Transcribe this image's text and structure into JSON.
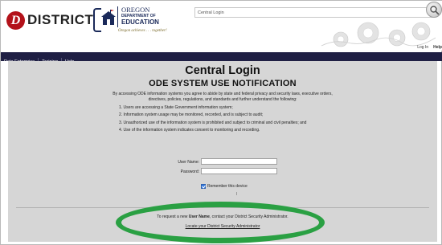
{
  "header": {
    "logo_letter": "D",
    "logo_brand": "DISTRICT",
    "oregon": "OREGON",
    "department": "DEPARTMENT OF",
    "education": "EDUCATION",
    "tagline": "Oregon achieves . . . together!",
    "page_label": "Central Login"
  },
  "top_links": {
    "login": "Log In",
    "help": "Help"
  },
  "nav": {
    "items": [
      "Data Enterprise",
      "Training",
      "Help"
    ]
  },
  "main": {
    "title": "Central Login",
    "subtitle": "ODE SYSTEM USE NOTIFICATION",
    "intro": "By accessing ODE information systems you agree to abide by state and federal privacy and security laws, executive orders, directives, policies, regulations, and standards and further understand the following:",
    "notices": [
      "1. Users are accessing a State Government information system;",
      "2. Information system usage may be monitored, recorded, and is subject to audit;",
      "3. Unauthorized use of the information system is prohibited and subject to criminal and civil penalties; and",
      "4. Use of the information system indicates consent to monitoring and recording."
    ],
    "username_label": "User Name:",
    "username_value": "",
    "password_label": "Password:",
    "password_value": "",
    "remember_label": "Remember this device",
    "remember_checked": true,
    "request_prefix": "To request a new ",
    "request_bold": "User Name",
    "request_suffix": ", contact your District Security Administrator.",
    "locate_link": "Locate your District Security Administrator"
  },
  "colors": {
    "nav_bg": "#1f1f44",
    "panel_bg": "#d6d6d6",
    "highlight": "#2aa043",
    "brand_red": "#b3121a",
    "brand_navy": "#1b2a5a"
  },
  "icons": {
    "search": "search-icon",
    "gears": "gears-icon",
    "schoolhouse": "schoolhouse-icon",
    "checkbox": "checkbox-checked-icon"
  }
}
